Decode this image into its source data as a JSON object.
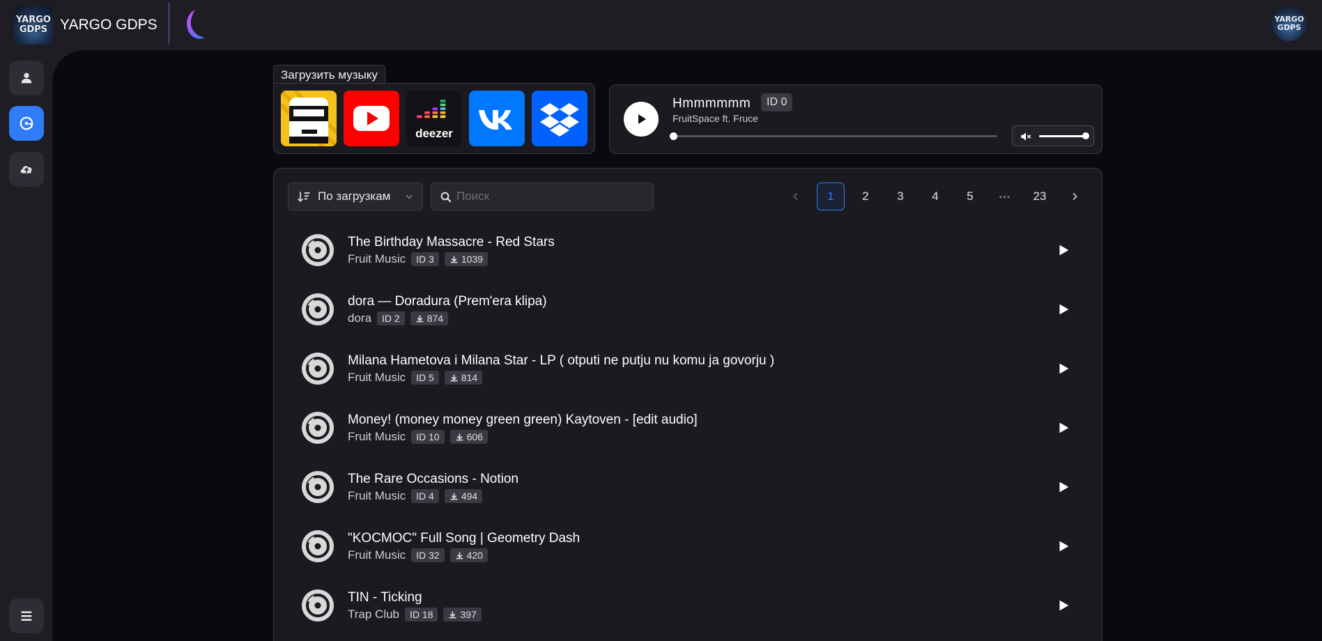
{
  "header": {
    "brand": "YARGO GDPS",
    "logo_text": "YARGO GDPS",
    "avatar_text": "YARGO GDPS"
  },
  "sidebar": {
    "items": [
      {
        "name": "profile",
        "icon": "user-icon",
        "active": false
      },
      {
        "name": "music",
        "icon": "music-disc-icon",
        "active": true
      },
      {
        "name": "upload",
        "icon": "cloud-upload-icon",
        "active": false
      }
    ],
    "menu_icon": "hamburger-menu-icon"
  },
  "upload": {
    "label": "Загрузить музыку",
    "services": [
      {
        "name": "newgrounds",
        "label": ""
      },
      {
        "name": "youtube",
        "label": ""
      },
      {
        "name": "deezer",
        "label": "deezer"
      },
      {
        "name": "vk",
        "label": ""
      },
      {
        "name": "dropbox",
        "label": ""
      }
    ]
  },
  "player": {
    "title": "Hmmmmmm",
    "id_badge": "ID 0",
    "artist": "FruitSpace ft. Fruce",
    "progress": 0,
    "volume": 1.0
  },
  "list": {
    "sort_label": "По загрузкам",
    "search_placeholder": "Поиск",
    "pages": [
      "1",
      "2",
      "3",
      "4",
      "5",
      "•••",
      "23"
    ],
    "current_page": "1",
    "songs": [
      {
        "title": "The Birthday Massacre - Red Stars",
        "artist": "Fruit Music",
        "id": "ID 3",
        "downloads": "1039"
      },
      {
        "title": "dora — Doradura (Prem'era klipa)",
        "artist": "dora",
        "id": "ID 2",
        "downloads": "874"
      },
      {
        "title": "Milana Hametova i Milana Star - LP ( otputi ne putju nu komu ja govorju )",
        "artist": "Fruit Music",
        "id": "ID 5",
        "downloads": "814"
      },
      {
        "title": "Money! (money money green green) Kaytoven - [edit audio]",
        "artist": "Fruit Music",
        "id": "ID 10",
        "downloads": "606"
      },
      {
        "title": "The Rare Occasions - Notion",
        "artist": "Fruit Music",
        "id": "ID 4",
        "downloads": "494"
      },
      {
        "title": "\"KOCMOC\" Full Song | Geometry Dash",
        "artist": "Fruit Music",
        "id": "ID 32",
        "downloads": "420"
      },
      {
        "title": "TIN - Ticking",
        "artist": "Trap Club",
        "id": "ID 18",
        "downloads": "397"
      }
    ]
  },
  "colors": {
    "accent": "#2f7cf6",
    "bg": "#1e1d23",
    "main_bg": "#09090f",
    "panel": "#1a1a20",
    "youtube": "#ff0000",
    "vk": "#0077ff",
    "dropbox": "#0061fe"
  }
}
